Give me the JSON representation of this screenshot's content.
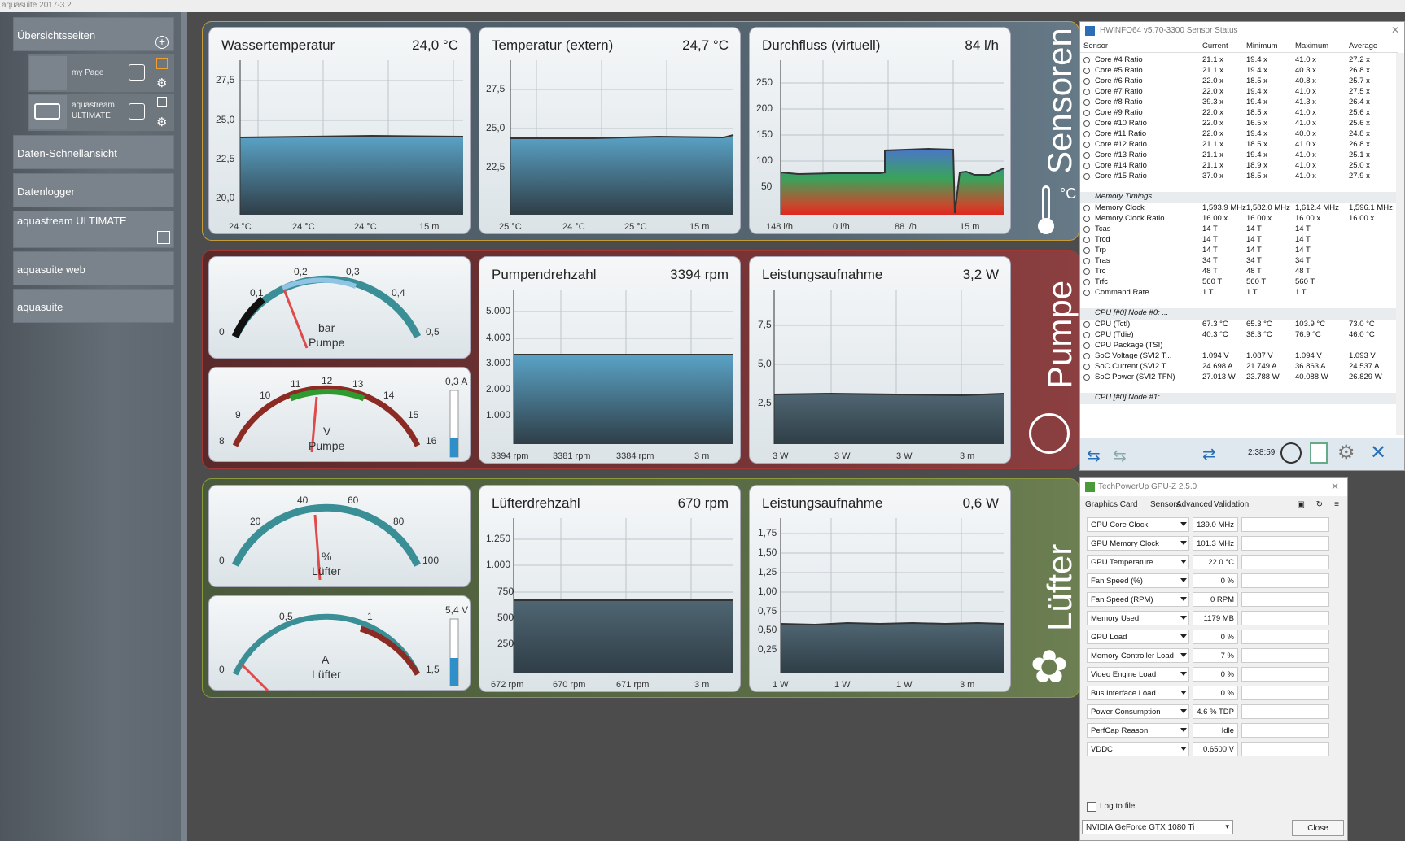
{
  "window_title": "aquasuite 2017-3.2",
  "sidebar": {
    "overview": "Übersichtsseiten",
    "pages": [
      {
        "label": "my Page"
      },
      {
        "label": "aquastream ULTIMATE"
      }
    ],
    "items": [
      "Daten-Schnellansicht",
      "Datenlogger",
      "aquastream ULTIMATE",
      "aquasuite web",
      "aquasuite"
    ]
  },
  "groups": [
    "Sensoren",
    "Pumpe",
    "Lüfter"
  ],
  "sensor_unit": "°C",
  "panels": {
    "water": {
      "title": "Wassertemperatur",
      "value": "24,0 °C",
      "ticks": [
        "27,5",
        "25,0",
        "22,5",
        "20,0"
      ],
      "stats": [
        "24 °C",
        "24 °C",
        "24 °C",
        "15 m"
      ]
    },
    "ext": {
      "title": "Temperatur (extern)",
      "value": "24,7 °C",
      "ticks": [
        "27,5",
        "25,0",
        "22,5"
      ],
      "stats": [
        "25 °C",
        "24 °C",
        "25 °C",
        "15 m"
      ]
    },
    "flow": {
      "title": "Durchfluss (virtuell)",
      "value": "84 l/h",
      "ticks": [
        "250",
        "200",
        "150",
        "100",
        "50"
      ],
      "stats": [
        "148 l/h",
        "0 l/h",
        "88 l/h",
        "15 m"
      ]
    },
    "pump_rpm": {
      "title": "Pumpendrehzahl",
      "value": "3394 rpm",
      "ticks": [
        "5.000",
        "4.000",
        "3.000",
        "2.000",
        "1.000"
      ],
      "stats": [
        "3394 rpm",
        "3381 rpm",
        "3384 rpm",
        "3 m"
      ]
    },
    "pump_power": {
      "title": "Leistungsaufnahme",
      "value": "3,2 W",
      "ticks": [
        "7,5",
        "5,0",
        "2,5"
      ],
      "stats": [
        "3 W",
        "3 W",
        "3 W",
        "3 m"
      ]
    },
    "fan_rpm": {
      "title": "Lüfterdrehzahl",
      "value": "670 rpm",
      "ticks": [
        "1.250",
        "1.000",
        "750",
        "500",
        "250"
      ],
      "stats": [
        "672 rpm",
        "670 rpm",
        "671 rpm",
        "3 m"
      ]
    },
    "fan_power": {
      "title": "Leistungsaufnahme",
      "value": "0,6 W",
      "ticks": [
        "1,75",
        "1,50",
        "1,25",
        "1,00",
        "0,75",
        "0,50",
        "0,25"
      ],
      "stats": [
        "1 W",
        "1 W",
        "1 W",
        "3 m"
      ]
    }
  },
  "gauges": {
    "bar": {
      "ticks": [
        "0",
        "0,1",
        "0,2",
        "0,3",
        "0,4",
        "0,5"
      ],
      "unit": "bar",
      "name": "Pumpe",
      "level": 0.17
    },
    "volt": {
      "ticks": [
        "8",
        "9",
        "10",
        "11",
        "12",
        "13",
        "14",
        "15",
        "16"
      ],
      "unit": "V",
      "name": "Pumpe",
      "side": "0,3 A",
      "level": 0.53,
      "bar_level": 0.3
    },
    "pct": {
      "ticks": [
        "0",
        "20",
        "40",
        "60",
        "80",
        "100"
      ],
      "unit": "%",
      "name": "Lüfter",
      "level": 0.44
    },
    "amp": {
      "ticks": [
        "0",
        "0,5",
        "1",
        "1,5"
      ],
      "unit": "A",
      "name": "Lüfter",
      "side": "5,4 V",
      "level": 0.02,
      "bar_level": 0.45
    }
  },
  "hwinfo": {
    "title": "HWiNFO64 v5.70-3300 Sensor Status",
    "columns": [
      "Sensor",
      "Current",
      "Minimum",
      "Maximum",
      "Average"
    ],
    "rows": [
      [
        "Core #4 Ratio",
        "21.1 x",
        "19.4 x",
        "41.0 x",
        "27.2 x"
      ],
      [
        "Core #5 Ratio",
        "21.1 x",
        "19.4 x",
        "40.3 x",
        "26.8 x"
      ],
      [
        "Core #6 Ratio",
        "22.0 x",
        "18.5 x",
        "40.8 x",
        "25.7 x"
      ],
      [
        "Core #7 Ratio",
        "22.0 x",
        "19.4 x",
        "41.0 x",
        "27.5 x"
      ],
      [
        "Core #8 Ratio",
        "39.3 x",
        "19.4 x",
        "41.3 x",
        "26.4 x"
      ],
      [
        "Core #9 Ratio",
        "22.0 x",
        "18.5 x",
        "41.0 x",
        "25.6 x"
      ],
      [
        "Core #10 Ratio",
        "22.0 x",
        "16.5 x",
        "41.0 x",
        "25.6 x"
      ],
      [
        "Core #11 Ratio",
        "22.0 x",
        "19.4 x",
        "40.0 x",
        "24.8 x"
      ],
      [
        "Core #12 Ratio",
        "21.1 x",
        "18.5 x",
        "41.0 x",
        "26.8 x"
      ],
      [
        "Core #13 Ratio",
        "21.1 x",
        "19.4 x",
        "41.0 x",
        "25.1 x"
      ],
      [
        "Core #14 Ratio",
        "21.1 x",
        "18.9 x",
        "41.0 x",
        "25.0 x"
      ],
      [
        "Core #15 Ratio",
        "37.0 x",
        "18.5 x",
        "41.0 x",
        "27.9 x"
      ],
      [
        "",
        "",
        "",
        "",
        ""
      ],
      [
        "#Memory Timings",
        "",
        "",
        "",
        ""
      ],
      [
        "Memory Clock",
        "1,593.9 MHz",
        "1,582.0 MHz",
        "1,612.4 MHz",
        "1,596.1 MHz"
      ],
      [
        "Memory Clock Ratio",
        "16.00 x",
        "16.00 x",
        "16.00 x",
        "16.00 x"
      ],
      [
        "Tcas",
        "14 T",
        "14 T",
        "14 T",
        ""
      ],
      [
        "Trcd",
        "14 T",
        "14 T",
        "14 T",
        ""
      ],
      [
        "Trp",
        "14 T",
        "14 T",
        "14 T",
        ""
      ],
      [
        "Tras",
        "34 T",
        "34 T",
        "34 T",
        ""
      ],
      [
        "Trc",
        "48 T",
        "48 T",
        "48 T",
        ""
      ],
      [
        "Trfc",
        "560 T",
        "560 T",
        "560 T",
        ""
      ],
      [
        "Command Rate",
        "1 T",
        "1 T",
        "1 T",
        ""
      ],
      [
        "",
        "",
        "",
        "",
        ""
      ],
      [
        "#CPU [#0] Node #0: ...",
        "",
        "",
        "",
        ""
      ],
      [
        "CPU (Tctl)",
        "67.3 °C",
        "65.3 °C",
        "103.9 °C",
        "73.0 °C"
      ],
      [
        "CPU (Tdie)",
        "40.3 °C",
        "38.3 °C",
        "76.9 °C",
        "46.0 °C"
      ],
      [
        "CPU Package (TSI)",
        "",
        "",
        "",
        ""
      ],
      [
        "SoC Voltage (SVI2 T...",
        "1.094 V",
        "1.087 V",
        "1.094 V",
        "1.093 V"
      ],
      [
        "SoC Current (SVI2 T...",
        "24.698 A",
        "21.749 A",
        "36.863 A",
        "24.537 A"
      ],
      [
        "SoC Power (SVI2 TFN)",
        "27.013 W",
        "23.788 W",
        "40.088 W",
        "26.829 W"
      ],
      [
        "",
        "",
        "",
        "",
        ""
      ],
      [
        "#CPU [#0] Node #1: ...",
        "",
        "",
        "",
        ""
      ]
    ],
    "timer": "2:38:59"
  },
  "gpuz": {
    "title": "TechPowerUp GPU-Z 2.5.0",
    "tabs": [
      "Graphics Card",
      "Sensors",
      "Advanced",
      "Validation"
    ],
    "rows": [
      [
        "GPU Core Clock",
        "139.0 MHz"
      ],
      [
        "GPU Memory Clock",
        "101.3 MHz"
      ],
      [
        "GPU Temperature",
        "22.0 °C"
      ],
      [
        "Fan Speed (%)",
        "0 %"
      ],
      [
        "Fan Speed (RPM)",
        "0 RPM"
      ],
      [
        "Memory Used",
        "1179 MB"
      ],
      [
        "GPU Load",
        "0 %"
      ],
      [
        "Memory Controller Load",
        "7 %"
      ],
      [
        "Video Engine Load",
        "0 %"
      ],
      [
        "Bus Interface Load",
        "0 %"
      ],
      [
        "Power Consumption",
        "4.6 % TDP"
      ],
      [
        "PerfCap Reason",
        "Idle"
      ],
      [
        "VDDC",
        "0.6500 V"
      ]
    ],
    "log": "Log to file",
    "device": "NVIDIA GeForce GTX 1080 Ti",
    "close": "Close"
  }
}
